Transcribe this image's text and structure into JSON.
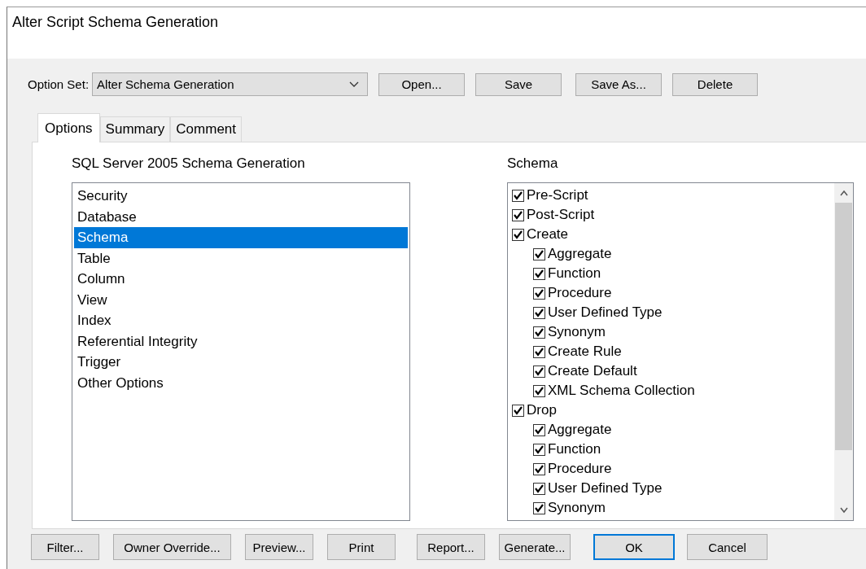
{
  "window": {
    "title": "Alter Script Schema Generation"
  },
  "option_set": {
    "label": "Option Set:",
    "value": "Alter Schema Generation"
  },
  "top_buttons": [
    "Open...",
    "Save",
    "Save As...",
    "Delete"
  ],
  "tabs": [
    {
      "label": "Options",
      "selected": true
    },
    {
      "label": "Summary",
      "selected": false
    },
    {
      "label": "Comment",
      "selected": false
    }
  ],
  "categories": {
    "title": "SQL Server 2005 Schema Generation",
    "items": [
      {
        "label": "Security",
        "selected": false
      },
      {
        "label": "Database",
        "selected": false
      },
      {
        "label": "Schema",
        "selected": true
      },
      {
        "label": "Table",
        "selected": false
      },
      {
        "label": "Column",
        "selected": false
      },
      {
        "label": "View",
        "selected": false
      },
      {
        "label": "Index",
        "selected": false
      },
      {
        "label": "Referential Integrity",
        "selected": false
      },
      {
        "label": "Trigger",
        "selected": false
      },
      {
        "label": "Other Options",
        "selected": false
      }
    ]
  },
  "schema": {
    "title": "Schema",
    "items": [
      {
        "label": "Pre-Script",
        "checked": true
      },
      {
        "label": "Post-Script",
        "checked": true
      },
      {
        "label": "Create",
        "checked": true,
        "children": [
          {
            "label": "Aggregate",
            "checked": true
          },
          {
            "label": "Function",
            "checked": true
          },
          {
            "label": "Procedure",
            "checked": true
          },
          {
            "label": "User Defined Type",
            "checked": true
          },
          {
            "label": "Synonym",
            "checked": true
          },
          {
            "label": "Create Rule",
            "checked": true
          },
          {
            "label": "Create Default",
            "checked": true
          },
          {
            "label": "XML Schema Collection",
            "checked": true
          }
        ]
      },
      {
        "label": "Drop",
        "checked": true,
        "children": [
          {
            "label": "Aggregate",
            "checked": true
          },
          {
            "label": "Function",
            "checked": true
          },
          {
            "label": "Procedure",
            "checked": true
          },
          {
            "label": "User Defined Type",
            "checked": true
          },
          {
            "label": "Synonym",
            "checked": true
          }
        ]
      }
    ]
  },
  "bottom_buttons": [
    {
      "label": "Filter...",
      "default": false
    },
    {
      "label": "Owner Override...",
      "default": false
    },
    {
      "label": "Preview...",
      "default": false
    },
    {
      "label": "Print",
      "default": false
    },
    {
      "label": "Report...",
      "default": false
    },
    {
      "label": "Generate...",
      "default": false
    },
    {
      "label": "OK",
      "default": true
    },
    {
      "label": "Cancel",
      "default": false
    }
  ]
}
